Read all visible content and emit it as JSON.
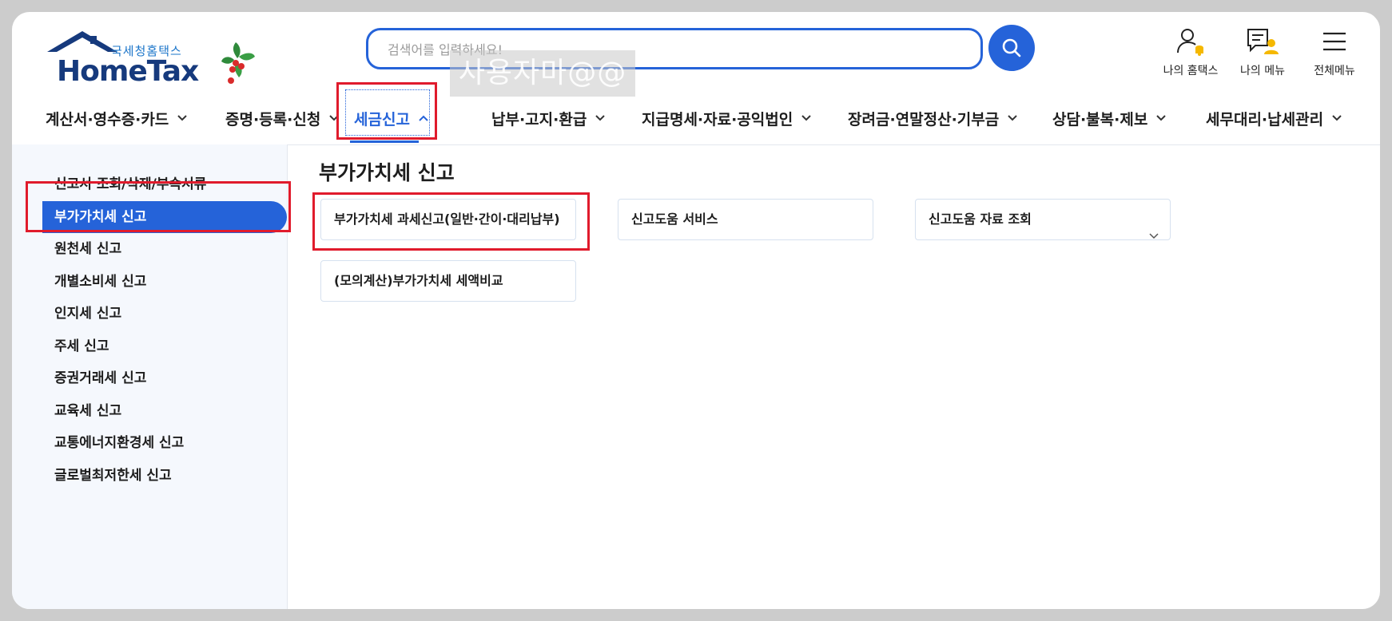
{
  "logo": {
    "subtitle": "국세청홈택스",
    "name": "HomeTax"
  },
  "search": {
    "placeholder": "검색어를 입력하세요!"
  },
  "watermark": "사용자마@@",
  "utility": [
    {
      "label": "나의 홈택스",
      "icon": "user-bell-icon"
    },
    {
      "label": "나의 메뉴",
      "icon": "my-menu-icon"
    },
    {
      "label": "전체메뉴",
      "icon": "hamburger-icon"
    }
  ],
  "nav": [
    {
      "label": "계산서·영수증·카드"
    },
    {
      "label": "증명·등록·신청"
    },
    {
      "label": "세금신고",
      "active": true
    },
    {
      "label": "납부·고지·환급"
    },
    {
      "label": "지급명세·자료·공익법인"
    },
    {
      "label": "장려금·연말정산·기부금"
    },
    {
      "label": "상담·불복·제보"
    },
    {
      "label": "세무대리·납세관리"
    }
  ],
  "sidebar": {
    "items": [
      {
        "label": "신고서 조회/삭제/부속서류"
      },
      {
        "label": "부가가치세 신고",
        "selected": true
      },
      {
        "label": "원천세 신고"
      },
      {
        "label": "개별소비세 신고"
      },
      {
        "label": "인지세 신고"
      },
      {
        "label": "주세 신고"
      },
      {
        "label": "증권거래세 신고"
      },
      {
        "label": "교육세 신고"
      },
      {
        "label": "교통에너지환경세 신고"
      },
      {
        "label": "글로벌최저한세 신고"
      }
    ]
  },
  "main": {
    "title": "부가가치세 신고",
    "cards": [
      {
        "label": "부가가치세 과세신고(일반·간이·대리납부)"
      },
      {
        "label": "신고도움 서비스"
      },
      {
        "label": "신고도움 자료 조회",
        "has_dropdown": true
      },
      {
        "label": "(모의계산)부가가치세 세액비교"
      }
    ]
  },
  "colors": {
    "accent": "#2563d9",
    "highlight": "#e01b2c",
    "logo_navy": "#163a7d",
    "sidebar_bg": "#f5f8fd"
  }
}
